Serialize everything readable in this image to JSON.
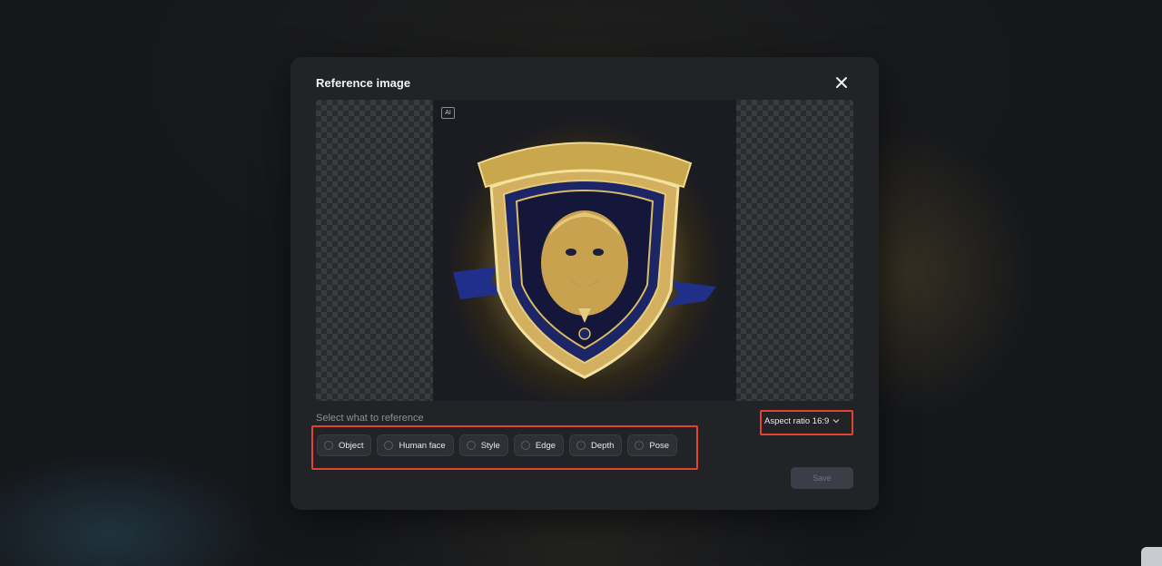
{
  "modal": {
    "title": "Reference image",
    "ai_badge": "AI",
    "select_label": "Select what to reference",
    "options": [
      "Object",
      "Human face",
      "Style",
      "Edge",
      "Depth",
      "Pose"
    ],
    "aspect_ratio_label": "Aspect ratio 16:9",
    "save_label": "Save"
  },
  "icons": {
    "close": "close-icon",
    "chevron": "chevron-down-icon",
    "reference_image": "lion-shield-emblem"
  },
  "colors": {
    "modal_bg": "#222327",
    "highlight": "#e0452f",
    "save_disabled": "#3b3e46"
  }
}
